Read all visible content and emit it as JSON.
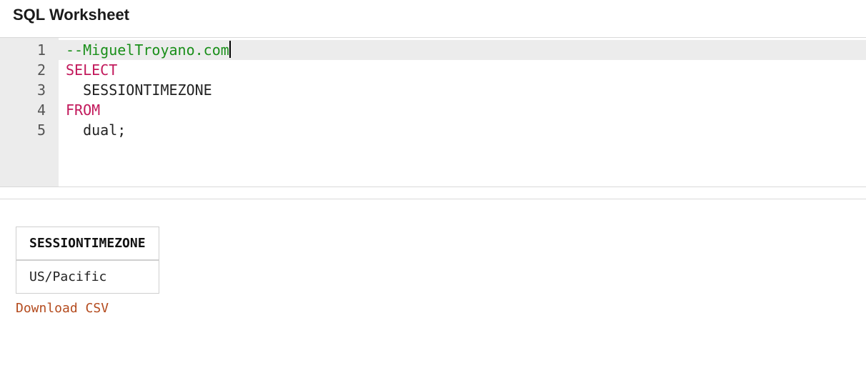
{
  "header": {
    "title": "SQL Worksheet"
  },
  "editor": {
    "gutter": [
      "1",
      "2",
      "3",
      "4",
      "5"
    ],
    "lines": [
      {
        "hl": true,
        "tokens": [
          {
            "cls": "tok-comment",
            "text": "--MiguelTroyano.com"
          }
        ],
        "cursorAfter": true
      },
      {
        "hl": false,
        "tokens": [
          {
            "cls": "tok-keyword",
            "text": "SELECT"
          }
        ]
      },
      {
        "hl": false,
        "tokens": [
          {
            "cls": "tok-ident",
            "text": "  SESSIONTIMEZONE"
          }
        ]
      },
      {
        "hl": false,
        "tokens": [
          {
            "cls": "tok-keyword",
            "text": "FROM"
          }
        ]
      },
      {
        "hl": false,
        "tokens": [
          {
            "cls": "tok-ident",
            "text": "  dual;"
          }
        ]
      }
    ]
  },
  "results": {
    "columns": [
      "SESSIONTIMEZONE"
    ],
    "rows": [
      [
        "US/Pacific"
      ]
    ],
    "download_label": "Download CSV"
  }
}
